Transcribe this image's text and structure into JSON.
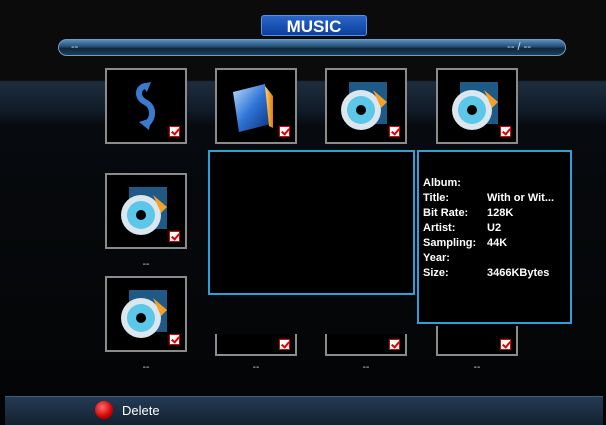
{
  "header": {
    "title": "MUSIC"
  },
  "progress": {
    "position": "--",
    "time": "-- / --"
  },
  "grid_items": [
    {
      "name": "back",
      "icon": "return-arrow-icon",
      "checked": true
    },
    {
      "name": "folder",
      "icon": "folder-icon",
      "checked": true
    },
    {
      "name": "music-file-1",
      "icon": "music-cd-icon",
      "checked": true
    },
    {
      "name": "music-file-2",
      "icon": "music-cd-icon",
      "checked": true
    },
    {
      "name": "music-file-3",
      "icon": "music-cd-icon",
      "checked": true,
      "caption": "--"
    },
    {
      "name": "music-file-4",
      "icon": "music-cd-icon",
      "checked": true,
      "caption": "--"
    }
  ],
  "bottom_captions": [
    "--",
    "--",
    "--"
  ],
  "info_panel": {
    "rows": [
      {
        "label": "Album:",
        "value": ""
      },
      {
        "label": "Title:",
        "value": "With or Wit..."
      },
      {
        "label": "Bit Rate:",
        "value": "128K"
      },
      {
        "label": "Artist:",
        "value": "U2"
      },
      {
        "label": "Sampling:",
        "value": "44K"
      },
      {
        "label": "Year:",
        "value": ""
      },
      {
        "label": "Size:",
        "value": "3466KBytes"
      }
    ]
  },
  "footer": {
    "delete_label": "Delete",
    "delete_button_color": "#d10000"
  },
  "colors": {
    "accent": "#2e9fd8",
    "title_bg": "#1a52b4"
  }
}
